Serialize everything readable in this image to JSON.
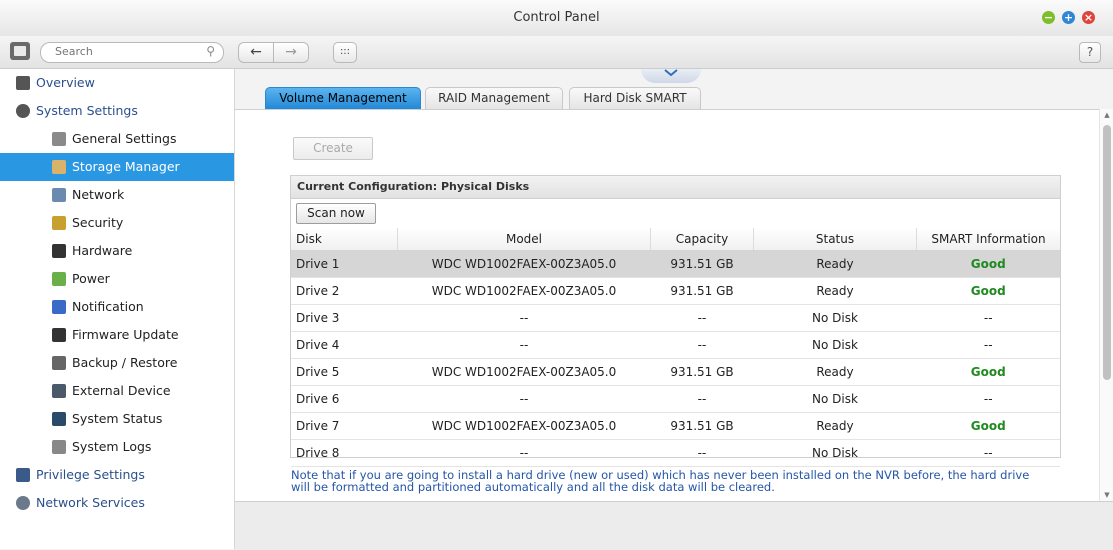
{
  "window": {
    "title": "Control Panel"
  },
  "toolbar": {
    "search_placeholder": "Search",
    "back": "←",
    "forward": "→",
    "grid": ":::",
    "help": "?"
  },
  "window_buttons": {
    "min": "−",
    "max": "+",
    "close": "×"
  },
  "sidebar": {
    "items": [
      {
        "label": "Overview",
        "icon": "overview-icon"
      },
      {
        "label": "System Settings",
        "icon": "gear-icon"
      },
      {
        "label": "General Settings",
        "icon": "general-settings-icon"
      },
      {
        "label": "Storage Manager",
        "icon": "storage-icon"
      },
      {
        "label": "Network",
        "icon": "network-icon"
      },
      {
        "label": "Security",
        "icon": "lock-icon"
      },
      {
        "label": "Hardware",
        "icon": "hardware-icon"
      },
      {
        "label": "Power",
        "icon": "power-icon"
      },
      {
        "label": "Notification",
        "icon": "notification-icon"
      },
      {
        "label": "Firmware Update",
        "icon": "firmware-icon"
      },
      {
        "label": "Backup / Restore",
        "icon": "backup-icon"
      },
      {
        "label": "External Device",
        "icon": "external-device-icon"
      },
      {
        "label": "System Status",
        "icon": "monitor-icon"
      },
      {
        "label": "System Logs",
        "icon": "logs-icon"
      },
      {
        "label": "Privilege Settings",
        "icon": "user-icon"
      },
      {
        "label": "Network Services",
        "icon": "globe-icon"
      }
    ]
  },
  "tabs": [
    {
      "label": "Volume Management"
    },
    {
      "label": "RAID Management"
    },
    {
      "label": "Hard Disk SMART"
    }
  ],
  "main": {
    "create_label": "Create",
    "panel_title": "Current Configuration: Physical Disks",
    "scan_label": "Scan now",
    "columns": [
      "Disk",
      "Model",
      "Capacity",
      "Status",
      "SMART Information"
    ],
    "rows": [
      [
        "Drive 1",
        "WDC WD1002FAEX-00Z3A05.0",
        "931.51 GB",
        "Ready",
        "Good"
      ],
      [
        "Drive 2",
        "WDC WD1002FAEX-00Z3A05.0",
        "931.51 GB",
        "Ready",
        "Good"
      ],
      [
        "Drive 3",
        "--",
        "--",
        "No Disk",
        "--"
      ],
      [
        "Drive 4",
        "--",
        "--",
        "No Disk",
        "--"
      ],
      [
        "Drive 5",
        "WDC WD1002FAEX-00Z3A05.0",
        "931.51 GB",
        "Ready",
        "Good"
      ],
      [
        "Drive 6",
        "--",
        "--",
        "No Disk",
        "--"
      ],
      [
        "Drive 7",
        "WDC WD1002FAEX-00Z3A05.0",
        "931.51 GB",
        "Ready",
        "Good"
      ],
      [
        "Drive 8",
        "--",
        "--",
        "No Disk",
        "--"
      ]
    ],
    "note": "Note that if you are going to install a hard drive (new or used) which has never been installed on the NVR before, the hard drive will be formatted and partitioned automatically and all the disk data will be cleared."
  }
}
